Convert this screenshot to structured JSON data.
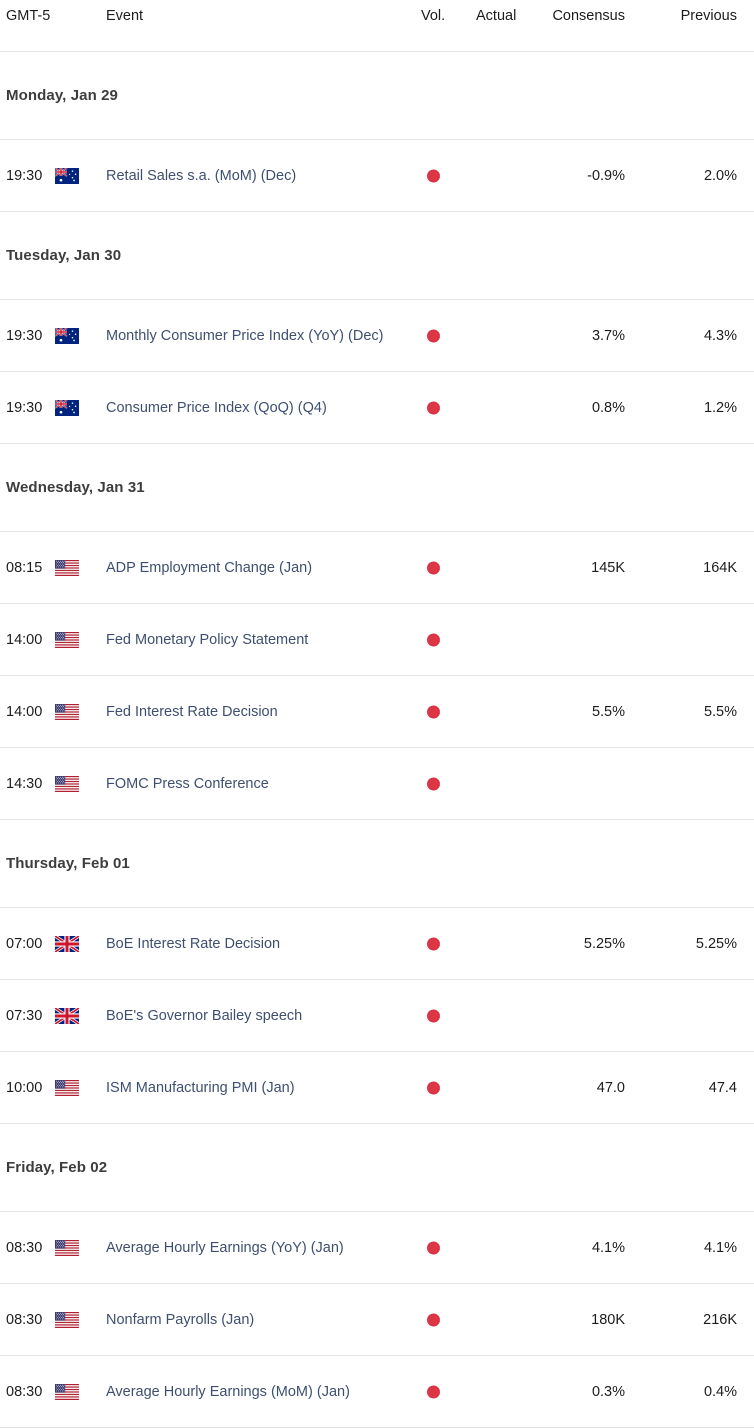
{
  "header": {
    "timezone": "GMT-5",
    "event": "Event",
    "vol": "Vol.",
    "actual": "Actual",
    "consensus": "Consensus",
    "previous": "Previous"
  },
  "colors": {
    "volatility_high": "#dc3545",
    "event_link": "#3f4f6f",
    "day_header": "#3d3d3d",
    "row_border": "#e3e3e3"
  },
  "days": [
    {
      "label": "Monday, Jan 29",
      "events": [
        {
          "time": "19:30",
          "flag": "australia-flag",
          "name": "Retail Sales s.a. (MoM) (Dec)",
          "volatility": "high-volatility-dot",
          "actual": "",
          "consensus": "-0.9%",
          "previous": "2.0%"
        }
      ]
    },
    {
      "label": "Tuesday, Jan 30",
      "events": [
        {
          "time": "19:30",
          "flag": "australia-flag",
          "name": "Monthly Consumer Price Index (YoY) (Dec)",
          "volatility": "high-volatility-dot",
          "actual": "",
          "consensus": "3.7%",
          "previous": "4.3%"
        },
        {
          "time": "19:30",
          "flag": "australia-flag",
          "name": "Consumer Price Index (QoQ) (Q4)",
          "volatility": "high-volatility-dot",
          "actual": "",
          "consensus": "0.8%",
          "previous": "1.2%"
        }
      ]
    },
    {
      "label": "Wednesday, Jan 31",
      "events": [
        {
          "time": "08:15",
          "flag": "united-states-flag",
          "name": "ADP Employment Change (Jan)",
          "volatility": "high-volatility-dot",
          "actual": "",
          "consensus": "145K",
          "previous": "164K"
        },
        {
          "time": "14:00",
          "flag": "united-states-flag",
          "name": "Fed Monetary Policy Statement",
          "volatility": "high-volatility-dot",
          "actual": "",
          "consensus": "",
          "previous": ""
        },
        {
          "time": "14:00",
          "flag": "united-states-flag",
          "name": "Fed Interest Rate Decision",
          "volatility": "high-volatility-dot",
          "actual": "",
          "consensus": "5.5%",
          "previous": "5.5%"
        },
        {
          "time": "14:30",
          "flag": "united-states-flag",
          "name": "FOMC Press Conference",
          "volatility": "high-volatility-dot",
          "actual": "",
          "consensus": "",
          "previous": ""
        }
      ]
    },
    {
      "label": "Thursday, Feb 01",
      "events": [
        {
          "time": "07:00",
          "flag": "united-kingdom-flag",
          "name": "BoE Interest Rate Decision",
          "volatility": "high-volatility-dot",
          "actual": "",
          "consensus": "5.25%",
          "previous": "5.25%"
        },
        {
          "time": "07:30",
          "flag": "united-kingdom-flag",
          "name": "BoE's Governor Bailey speech",
          "volatility": "high-volatility-dot",
          "actual": "",
          "consensus": "",
          "previous": ""
        },
        {
          "time": "10:00",
          "flag": "united-states-flag",
          "name": "ISM Manufacturing PMI (Jan)",
          "volatility": "high-volatility-dot",
          "actual": "",
          "consensus": "47.0",
          "previous": "47.4"
        }
      ]
    },
    {
      "label": "Friday, Feb 02",
      "events": [
        {
          "time": "08:30",
          "flag": "united-states-flag",
          "name": "Average Hourly Earnings (YoY) (Jan)",
          "volatility": "high-volatility-dot",
          "actual": "",
          "consensus": "4.1%",
          "previous": "4.1%"
        },
        {
          "time": "08:30",
          "flag": "united-states-flag",
          "name": "Nonfarm Payrolls (Jan)",
          "volatility": "high-volatility-dot",
          "actual": "",
          "consensus": "180K",
          "previous": "216K"
        },
        {
          "time": "08:30",
          "flag": "united-states-flag",
          "name": "Average Hourly Earnings (MoM) (Jan)",
          "volatility": "high-volatility-dot",
          "actual": "",
          "consensus": "0.3%",
          "previous": "0.4%"
        }
      ]
    }
  ]
}
